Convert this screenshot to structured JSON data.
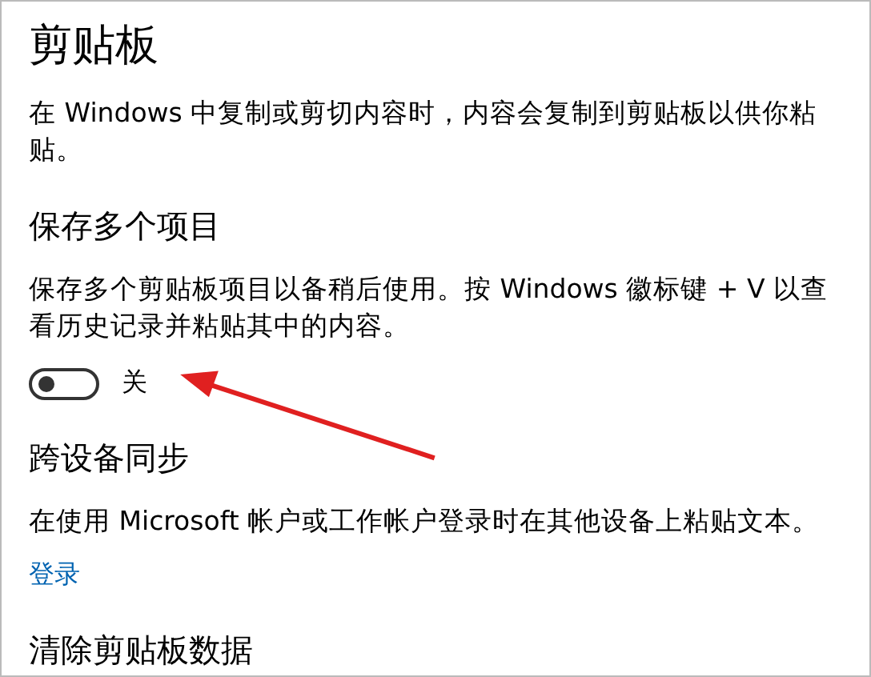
{
  "title": "剪贴板",
  "intro": "在 Windows 中复制或剪切内容时，内容会复制到剪贴板以供你粘贴。",
  "sections": [
    {
      "heading": "保存多个项目",
      "description": "保存多个剪贴板项目以备稍后使用。按 Windows 徽标键 + V 以查看历史记录并粘贴其中的内容。",
      "toggle": {
        "on": false,
        "label": "关"
      }
    },
    {
      "heading": "跨设备同步",
      "description": "在使用 Microsoft 帐户或工作帐户登录时在其他设备上粘贴文本。",
      "link": "登录"
    },
    {
      "heading": "清除剪贴板数据"
    }
  ]
}
